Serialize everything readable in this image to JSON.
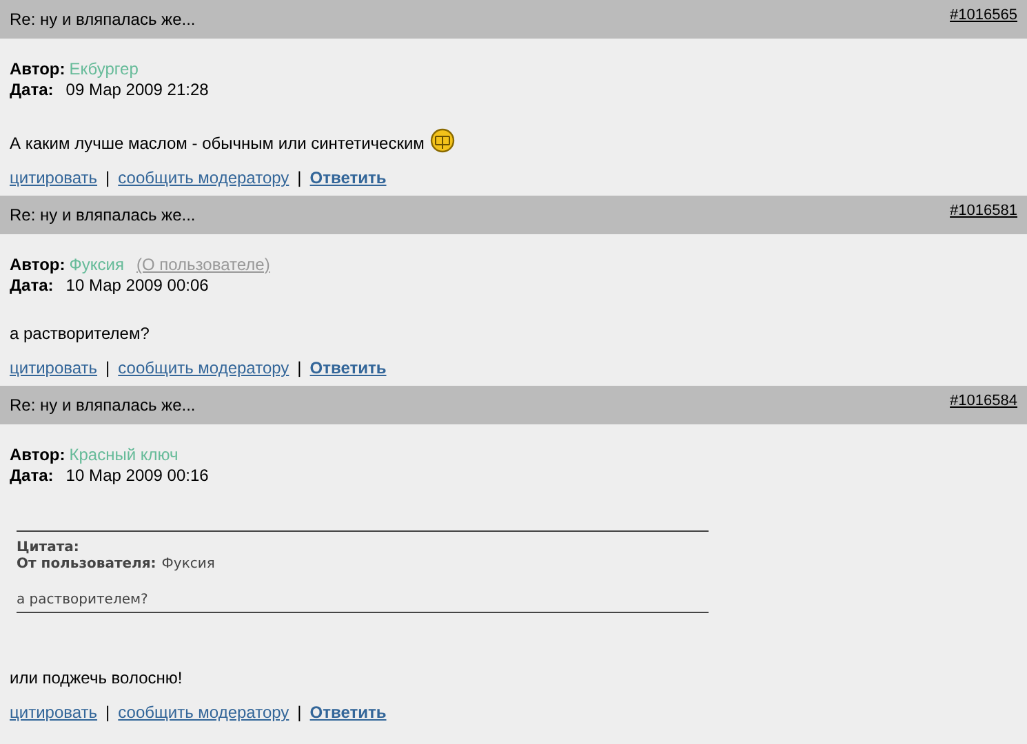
{
  "posts": [
    {
      "title": "Re: ну и вляпалась же...",
      "number": "#1016565",
      "author_label": "Автор:",
      "author": "Екбургер",
      "date_label": "Дата:",
      "date": "09 Мар 2009 21:28",
      "text": "А каким лучше маслом - обычным или синтетическим",
      "smiley": true,
      "actions": [
        {
          "kind": "link",
          "label": "цитировать"
        },
        {
          "kind": "separator",
          "label": "|"
        },
        {
          "kind": "link",
          "label": "сообщить модератору"
        },
        {
          "kind": "separator",
          "label": "|"
        },
        {
          "kind": "reply",
          "label": "Ответить"
        }
      ]
    },
    {
      "title": "Re: ну и вляпалась же...",
      "number": "#1016581",
      "author_label": "Автор:",
      "author": "Фуксия",
      "profile_link": "(О пользователе)",
      "date_label": "Дата:",
      "date": "10 Мар 2009 00:06",
      "text": "а растворителем?",
      "smiley": false,
      "actions": [
        {
          "kind": "link",
          "label": "цитировать"
        },
        {
          "kind": "separator",
          "label": "|"
        },
        {
          "kind": "link",
          "label": "сообщить модератору"
        },
        {
          "kind": "separator",
          "label": "|"
        },
        {
          "kind": "reply",
          "label": "Ответить"
        }
      ]
    },
    {
      "title": "Re: ну и вляпалась же...",
      "number": "#1016584",
      "author_label": "Автор:",
      "author": "Красный ключ",
      "date_label": "Дата:",
      "date": "10 Мар 2009 00:16",
      "quote": {
        "heading": "Цитата:",
        "from_label": "От пользователя:",
        "from": "Фуксия",
        "text": "а растворителем?"
      },
      "text": "или поджечь волосню!",
      "smiley": false,
      "actions": [
        {
          "kind": "link",
          "label": "цитировать"
        },
        {
          "kind": "separator",
          "label": "|"
        },
        {
          "kind": "link",
          "label": "сообщить модератору"
        },
        {
          "kind": "separator",
          "label": "|"
        },
        {
          "kind": "reply",
          "label": "Ответить"
        }
      ]
    }
  ]
}
